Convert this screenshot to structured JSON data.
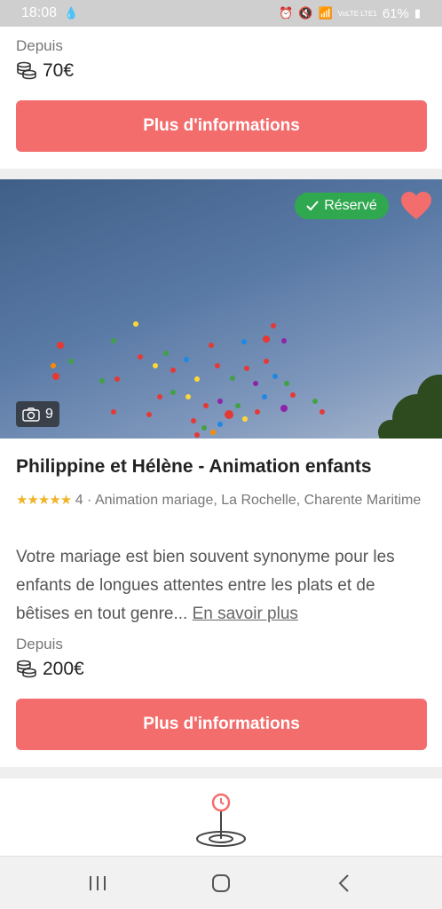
{
  "status_bar": {
    "time": "18:08",
    "battery": "61%",
    "network": "VoLTE LTE1"
  },
  "top_card": {
    "from_label": "Depuis",
    "price": "70€",
    "button_label": "Plus d'informations"
  },
  "main_card": {
    "badge": "Réservé",
    "photo_count": "9",
    "title": "Philippine et Hélène - Animation enfants",
    "rating_stars": "★★★★★",
    "rating_count": "4",
    "meta_text": " · Animation mariage, La Rochelle, Charente Maritime",
    "description": "Votre mariage est bien souvent synonyme pour les enfants de longues attentes entre les plats et de bêtises en tout genre... ",
    "read_more": "En savoir plus",
    "from_label": "Depuis",
    "price": "200€",
    "button_label": "Plus d'informations"
  },
  "colors": {
    "accent": "#f46d6d",
    "badge_green": "#2fa84f",
    "star_gold": "#f0b429"
  },
  "icons": [
    "coins-icon",
    "check-icon",
    "heart-icon",
    "camera-icon",
    "map-pin-icon",
    "recent-apps-icon",
    "home-icon",
    "back-icon"
  ]
}
